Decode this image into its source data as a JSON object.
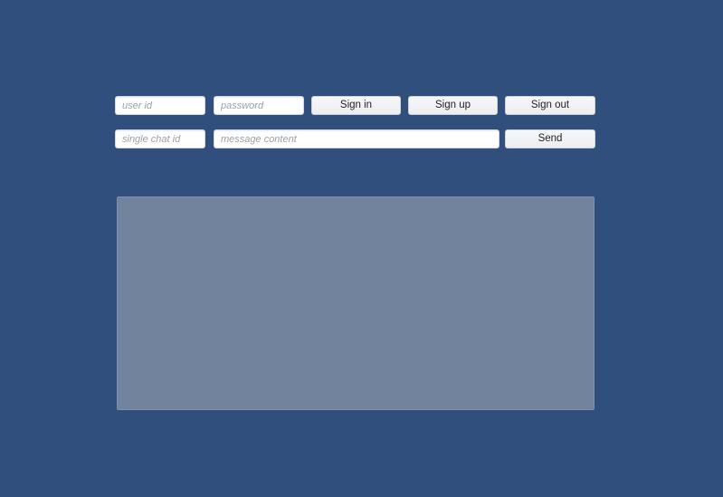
{
  "login": {
    "user_id_placeholder": "user id",
    "password_placeholder": "password",
    "sign_in_label": "Sign in",
    "sign_up_label": "Sign up",
    "sign_out_label": "Sign out"
  },
  "chat": {
    "chat_id_placeholder": "single chat id",
    "message_placeholder": "message content",
    "send_label": "Send"
  },
  "log": {
    "text": ""
  },
  "colors": {
    "background": "#314f7c",
    "panel": "#71839d"
  }
}
